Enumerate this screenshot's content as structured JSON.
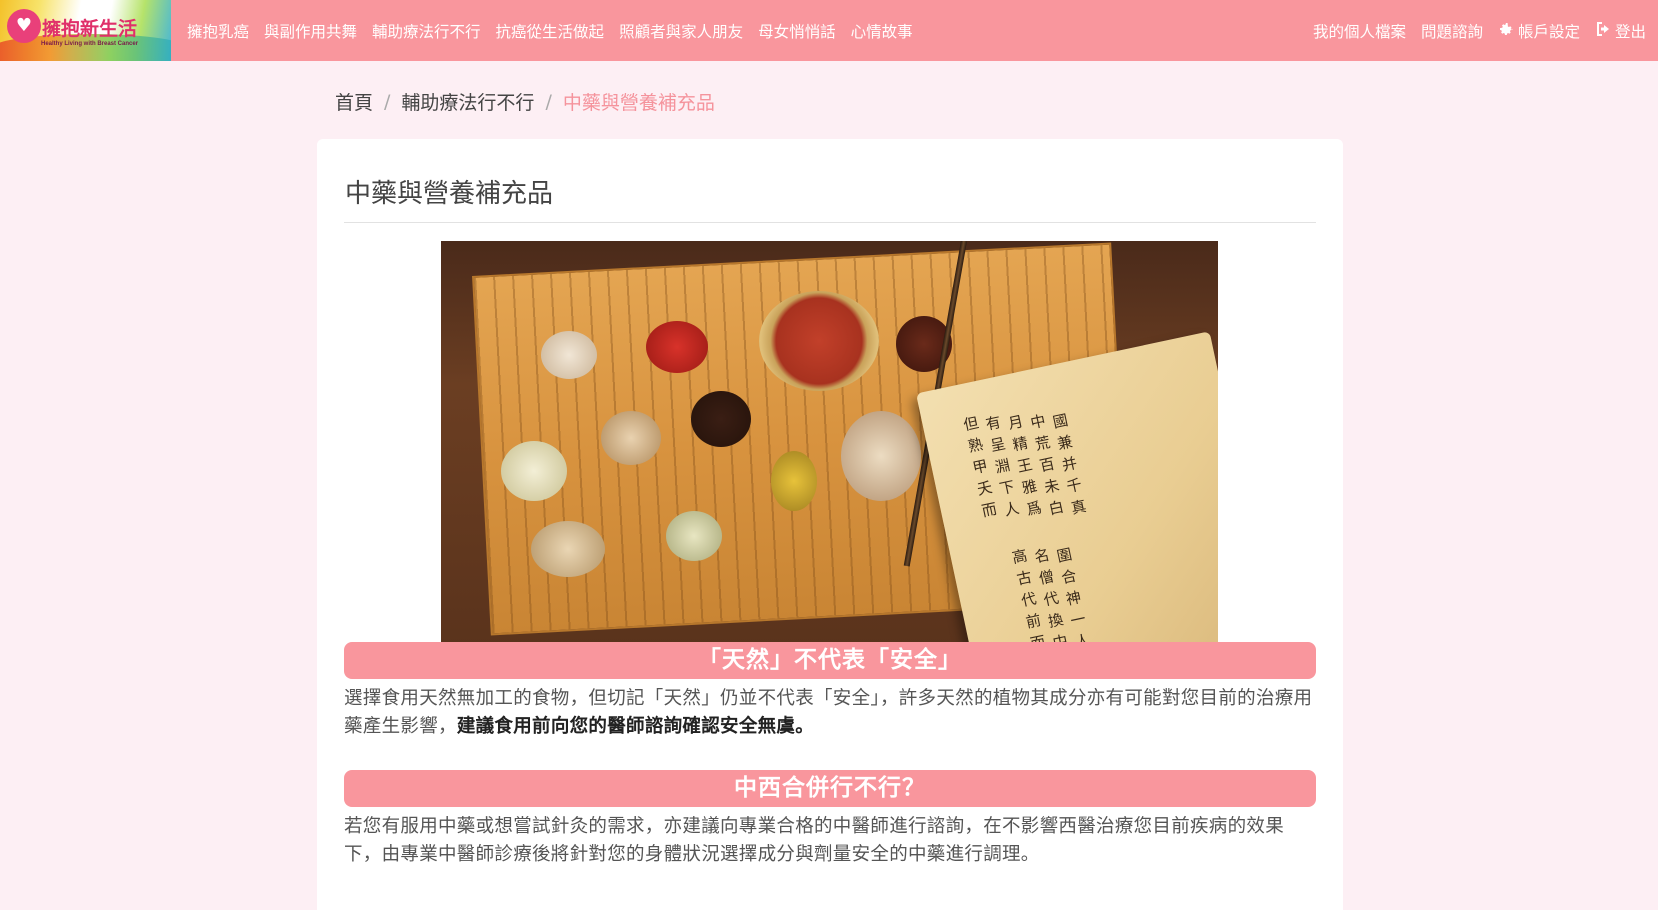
{
  "logo": {
    "title": "擁抱新生活",
    "subtitle": "Healthy Living with Breast Cancer"
  },
  "nav": {
    "left": [
      "擁抱乳癌",
      "與副作用共舞",
      "輔助療法行不行",
      "抗癌從生活做起",
      "照顧者與家人朋友",
      "母女悄悄話",
      "心情故事"
    ],
    "profile": "我的個人檔案",
    "consult": "問題諮詢",
    "settings": "帳戶設定",
    "logout": "登出"
  },
  "breadcrumb": {
    "home": "首頁",
    "section": "輔助療法行不行",
    "current": "中藥與營養補充品",
    "separator": "/"
  },
  "page": {
    "title": "中藥與營養補充品"
  },
  "sections": [
    {
      "heading": "「天然」不代表「安全」",
      "body": "選擇食用天然無加工的食物，但切記「天然」仍並不代表「安全」，許多天然的植物其成分亦有可能對您目前的治療用藥產生影響，",
      "body_strong": "建議食用前向您的醫師諮詢確認安全無虞。"
    },
    {
      "heading": "中西合併行不行？",
      "body": "若您有服用中藥或想嘗試針灸的需求，亦建議向專業合格的中醫師進行諮詢，在不影響西醫治療您目前疾病的效果下，由專業中醫師診療後將針對您的身體狀況選擇成分與劑量安全的中藥進行調理。"
    }
  ],
  "colors": {
    "navbar": "#f9969d",
    "page_bg": "#fdeff4",
    "accent": "#f5939c"
  },
  "icons": {
    "settings": "gear-icon",
    "logout": "sign-out-icon"
  }
}
